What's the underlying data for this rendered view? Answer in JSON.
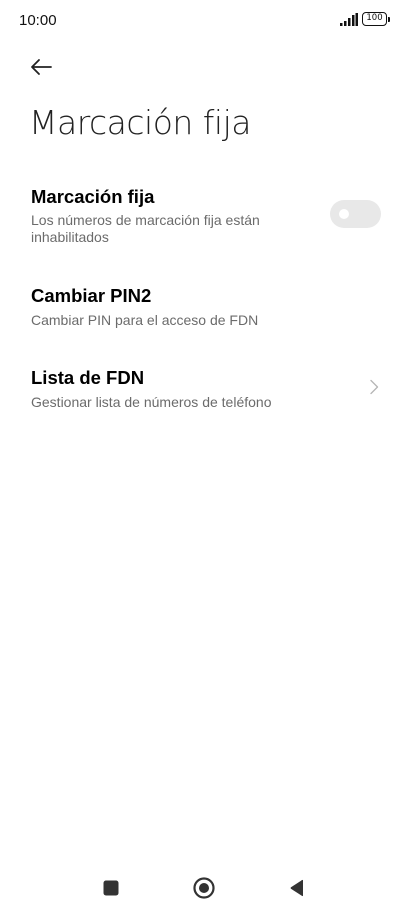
{
  "status_bar": {
    "time": "10:00",
    "battery_level": "100",
    "signal_icon": "signal-bars-icon",
    "battery_icon": "battery-icon"
  },
  "header": {
    "back_icon": "arrow-back-icon",
    "title": "Marcación fija"
  },
  "settings": [
    {
      "title": "Marcación fija",
      "subtitle": "Los números de marcación fija están inhabilitados",
      "control": "toggle",
      "toggle_on": false
    },
    {
      "title": "Cambiar PIN2",
      "subtitle": "Cambiar PIN para el acceso de FDN"
    },
    {
      "title": "Lista de FDN",
      "subtitle": "Gestionar lista de números de teléfono",
      "control": "chevron-right-icon"
    }
  ],
  "nav_bar": {
    "recents_icon": "square-icon",
    "home_icon": "circle-home-icon",
    "back_icon": "triangle-back-icon"
  },
  "colors": {
    "background": "#ffffff",
    "subtitle": "#6b6b6b",
    "toggle_off_track": "#e8e8e8",
    "nav_icon": "#333333"
  }
}
